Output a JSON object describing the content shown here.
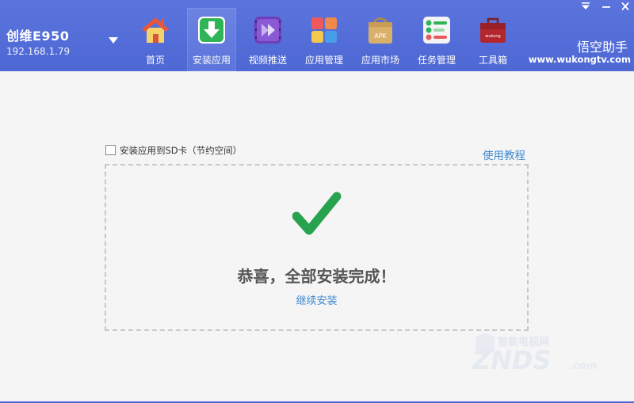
{
  "device": {
    "name": "创维E950",
    "ip": "192.168.1.79"
  },
  "nav": [
    {
      "label": "首页",
      "icon": "home-icon"
    },
    {
      "label": "安装应用",
      "icon": "install-download-icon"
    },
    {
      "label": "视频推送",
      "icon": "video-push-icon"
    },
    {
      "label": "应用管理",
      "icon": "app-manage-icon"
    },
    {
      "label": "应用市场",
      "icon": "apk-market-icon"
    },
    {
      "label": "任务管理",
      "icon": "task-manage-icon"
    },
    {
      "label": "工具箱",
      "icon": "toolbox-icon",
      "icon_text": "wukong"
    }
  ],
  "active_tab": "安装应用",
  "brand": {
    "title": "悟空助手",
    "url": "www.wukongtv.com"
  },
  "install": {
    "sd_option_label": "安装应用到SD卡（节约空间）",
    "sd_option_checked": false,
    "tutorial_link": "使用教程",
    "success_message": "恭喜，全部安装完成！",
    "continue_link": "继续安装"
  },
  "watermark": {
    "site": "智能电视网",
    "brand": "ZNDS",
    "suffix": ".com"
  },
  "colors": {
    "topbar": "#5069d6",
    "check": "#27a24f",
    "link": "#3f8ad0"
  }
}
